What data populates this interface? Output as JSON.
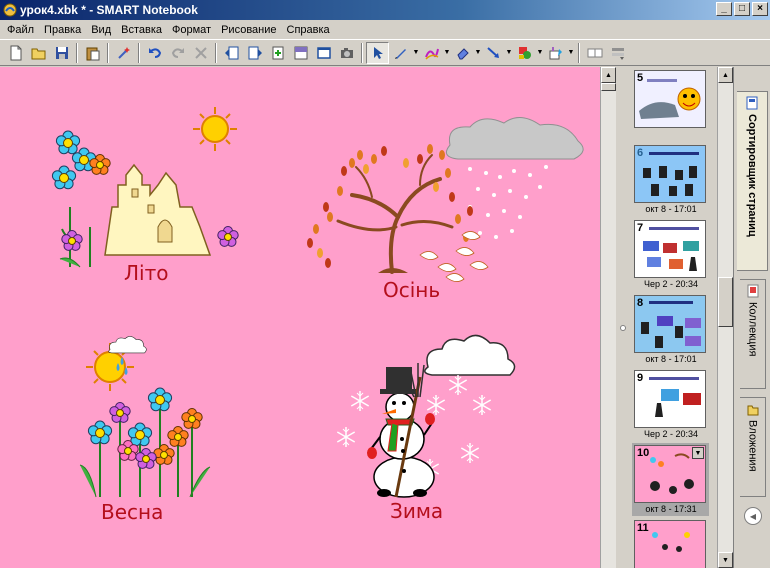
{
  "window": {
    "title": "урок4.xbk * - SMART Notebook",
    "minimize_glyph": "_",
    "maximize_glyph": "□",
    "close_glyph": "×"
  },
  "menu": {
    "items": [
      {
        "label": "Файл"
      },
      {
        "label": "Правка"
      },
      {
        "label": "Вид"
      },
      {
        "label": "Вставка"
      },
      {
        "label": "Формат"
      },
      {
        "label": "Рисование"
      },
      {
        "label": "Справка"
      }
    ]
  },
  "toolbar": {
    "icons": [
      "new-page-icon",
      "open-icon",
      "save-icon",
      "paste-icon",
      "magic-wand-icon",
      "undo-icon",
      "redo-icon",
      "delete-icon",
      "prev-page-icon",
      "next-page-icon",
      "add-page-icon",
      "screen-shade-icon",
      "full-screen-icon",
      "capture-icon",
      "select-icon",
      "pen-icon",
      "creative-pen-icon",
      "eraser-icon",
      "line-icon",
      "shapes-icon",
      "fill-icon",
      "table-icon",
      "dual-page-icon",
      "properties-icon"
    ]
  },
  "canvas": {
    "background": "#ff9fcb",
    "label_color": "#b40f1c",
    "seasons": {
      "summer": "Літо",
      "autumn": "Осінь",
      "spring": "Весна",
      "winter": "Зима"
    }
  },
  "sorter": {
    "pages": [
      {
        "number": "5",
        "caption": ""
      },
      {
        "number": "6",
        "caption": "окт 8 - 17:01"
      },
      {
        "number": "7",
        "caption": "Чер 2 - 20:34"
      },
      {
        "number": "8",
        "caption": "окт 8 - 17:01"
      },
      {
        "number": "9",
        "caption": "Чер 2 - 20:34"
      },
      {
        "number": "10",
        "caption": "окт 8 - 17:31",
        "selected": true
      },
      {
        "number": "11",
        "caption": ""
      }
    ],
    "dropdown_glyph": "▼"
  },
  "side_tabs": {
    "sorter": "Сортировщик страниц",
    "gallery": "Коллекция",
    "attachments": "Вложения"
  }
}
